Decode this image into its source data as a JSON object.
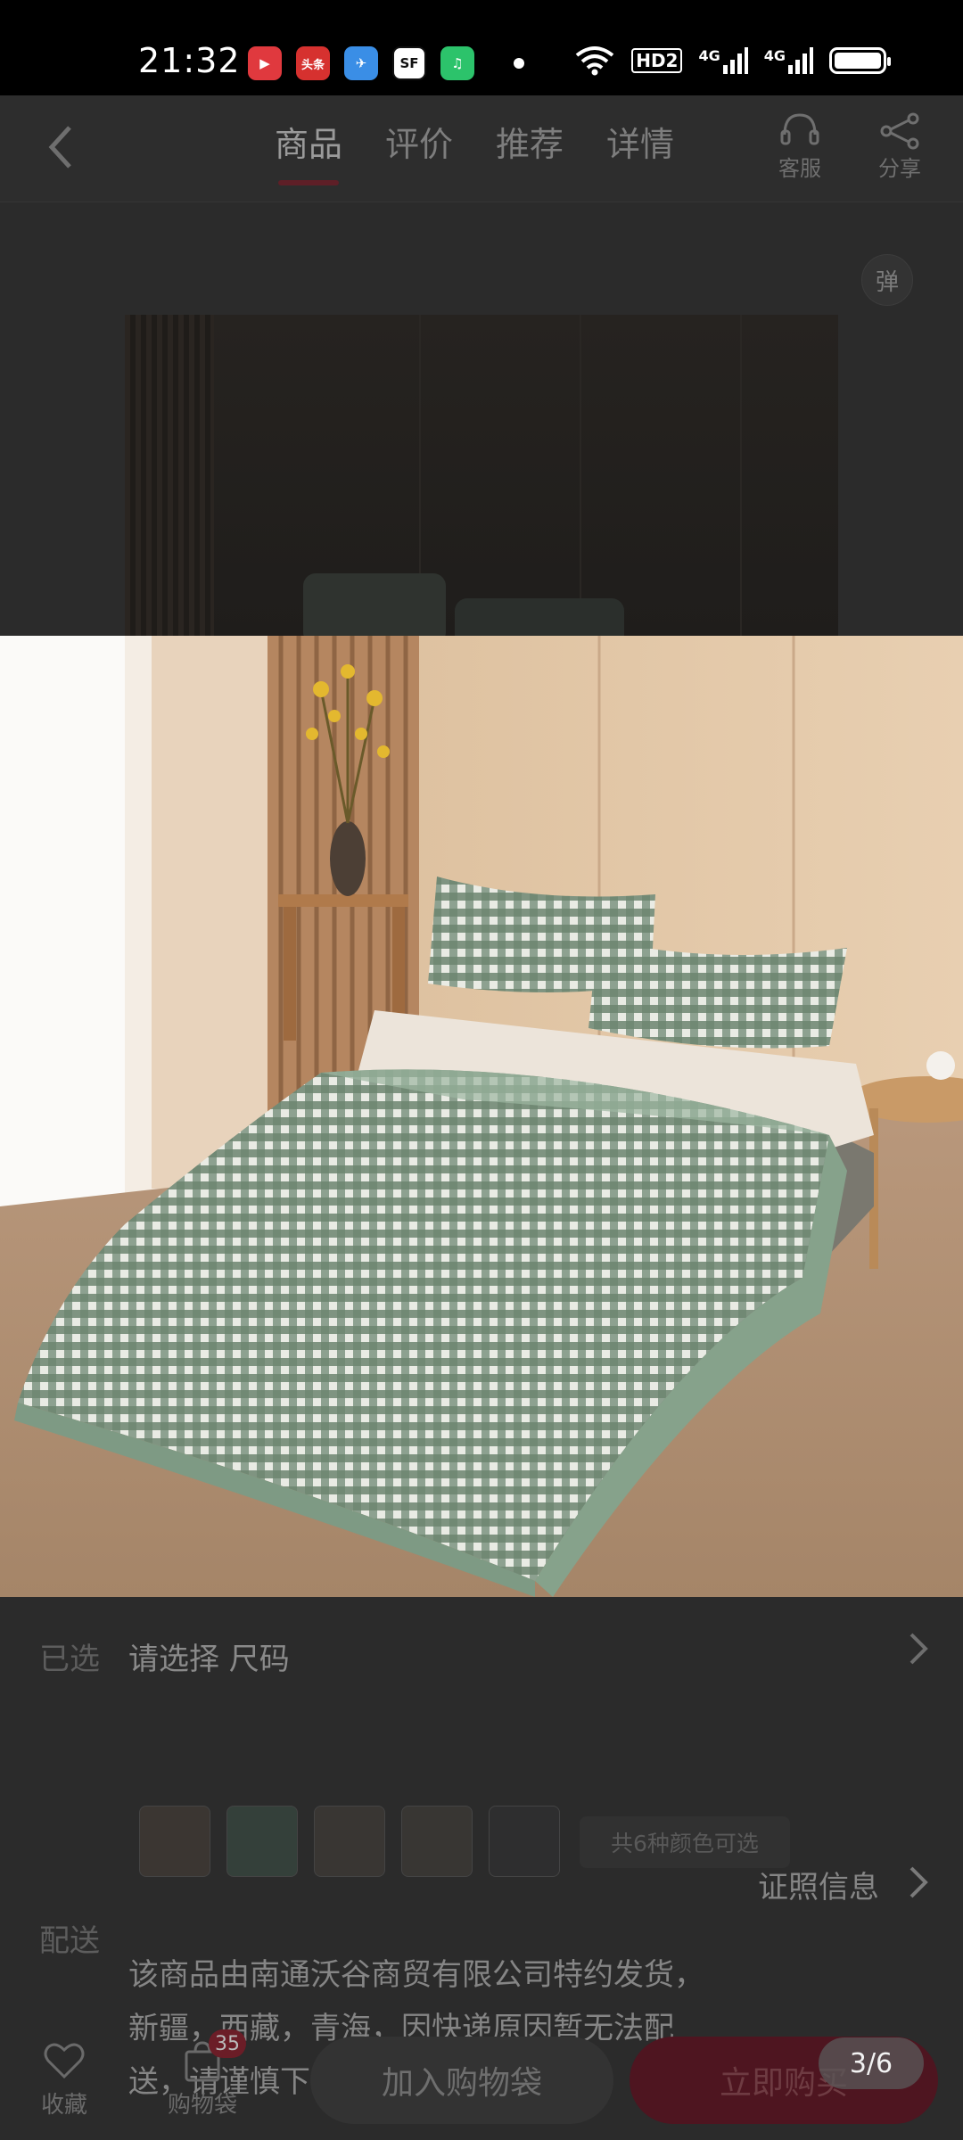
{
  "status_bar": {
    "time": "21:32",
    "apps": [
      {
        "icon": "video-app-icon",
        "text": "▶",
        "color": "#e0393e"
      },
      {
        "icon": "toutiao-app-icon",
        "text": "头条",
        "color": "#d6312f"
      },
      {
        "icon": "paper-plane-app-icon",
        "text": "✈",
        "color": "#3a8ee6"
      },
      {
        "icon": "sf-express-app-icon",
        "text": "SF",
        "color": "#ffffff"
      },
      {
        "icon": "green-app-icon",
        "text": "♫",
        "color": "#2cc36b"
      }
    ],
    "network_label_1": "HD2",
    "network_label_2": "4G",
    "network_label_3": "4G"
  },
  "nav": {
    "back_icon": "chevron-left-icon",
    "tabs": [
      "商品",
      "评价",
      "推荐",
      "详情"
    ],
    "active_tab": "商品",
    "service_label": "客服",
    "share_label": "分享",
    "danmu_label": "弹"
  },
  "selection": {
    "label": "已选",
    "value": "请选择 尺码",
    "swatch_count": 5,
    "colors_note": "共6种颜色可选"
  },
  "shipping": {
    "label": "配送",
    "text": "该商品由南通沃谷商贸有限公司特约发货，新疆，西藏，青海，因快递原因暂无法配送，请谨慎下单。",
    "license_link": "证照信息"
  },
  "bottom_bar": {
    "favorite_label": "收藏",
    "bag_label": "购物袋",
    "bag_count": "35",
    "add_to_bag": "加入购物袋",
    "buy_now": "立即购买"
  },
  "viewer": {
    "page_indicator": "3/6"
  },
  "colors": {
    "brand_dark_red": "#5e1f27",
    "checked_green": "#6f8a73"
  }
}
